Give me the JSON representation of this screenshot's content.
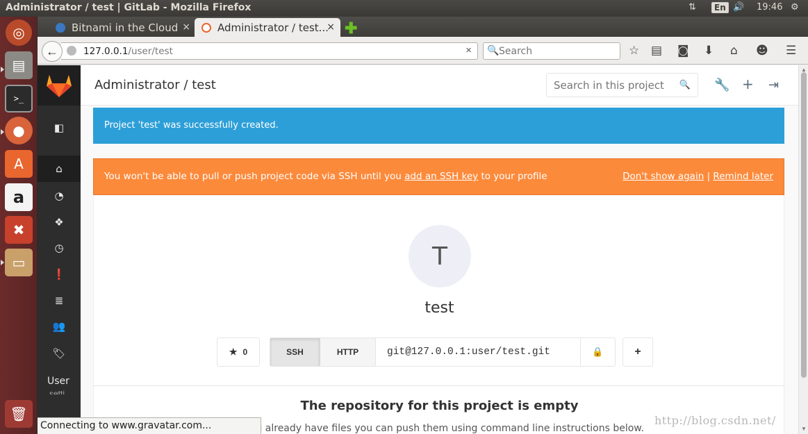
{
  "system": {
    "window_title": "Administrator / test | GitLab - Mozilla Firefox",
    "keyboard_layout": "En",
    "clock": "19:46"
  },
  "launcher": {
    "items": [
      {
        "name": "Dash",
        "icon": "ubuntu-logo-icon"
      },
      {
        "name": "Files",
        "icon": "file-cabinet-icon"
      },
      {
        "name": "Terminal",
        "icon": "terminal-icon"
      },
      {
        "name": "Firefox",
        "icon": "firefox-icon"
      },
      {
        "name": "Software Center",
        "icon": "shopping-bag-icon"
      },
      {
        "name": "Amazon",
        "icon": "amazon-icon"
      },
      {
        "name": "System Settings",
        "icon": "settings-icon"
      },
      {
        "name": "Archive",
        "icon": "box-icon"
      },
      {
        "name": "Trash",
        "icon": "trash-icon"
      }
    ],
    "terminal_glyph": ">_",
    "amazon_glyph": "a"
  },
  "browser": {
    "tabs": [
      {
        "title": "Bitnami in the Cloud",
        "active": false
      },
      {
        "title": "Administrator / test...",
        "active": true
      }
    ],
    "close_glyph": "×",
    "new_tab_glyph": "✚",
    "url_host": "127.0.0.1",
    "url_path": "/user/test",
    "url_clear_glyph": "×",
    "search_placeholder": "Search",
    "status_text": "Connecting to www.gravatar.com..."
  },
  "gitlab": {
    "header_title": "Administrator / test",
    "project_search_placeholder": "Search in this project",
    "sidebar_user_label": "User",
    "sidebar_user_sublabel": "setti",
    "flash_notice": "Project 'test' was successfully created.",
    "ssh_warning": {
      "prefix": "You won't be able to pull or push project code via SSH until you ",
      "link": "add an SSH key",
      "suffix": " to your profile",
      "dont_show": "Don't show again",
      "separator": "|",
      "remind": "Remind later"
    },
    "project": {
      "avatar_letter": "T",
      "name": "test",
      "star_count": "0",
      "ssh_label": "SSH",
      "http_label": "HTTP",
      "clone_url": "git@127.0.0.1:user/test.git"
    },
    "empty_title": "The repository for this project is empty",
    "empty_desc": "If you already have files you can push them using command line instructions below."
  },
  "watermark": "http://blog.csdn.net/",
  "colors": {
    "flash_blue": "#2d9fd8",
    "warning_orange": "#fc8a3b",
    "sidebar_dark": "#2d2d2d",
    "launcher_red": "#6b2b2b"
  }
}
